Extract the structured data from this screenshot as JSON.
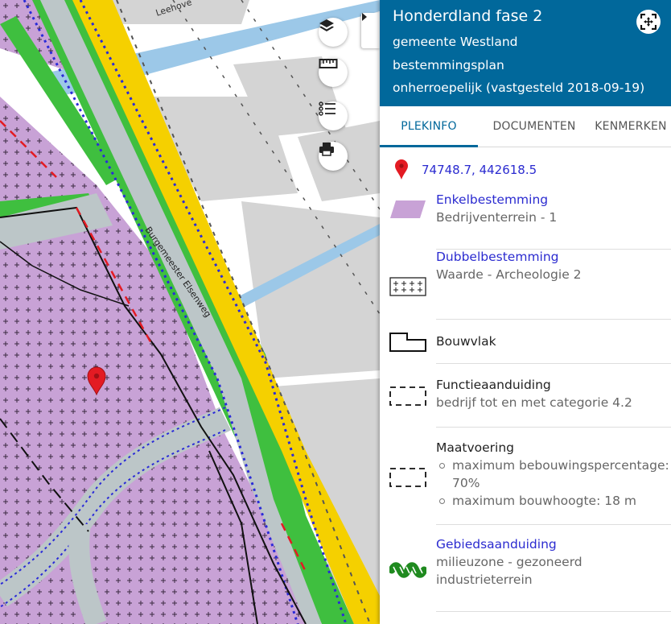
{
  "map": {
    "street_label_top": "Leehove",
    "street_label_diag": "Burgemeester Elsenweg",
    "controls": [
      {
        "name": "layers",
        "icon": "layers-icon"
      },
      {
        "name": "measure",
        "icon": "ruler-icon"
      },
      {
        "name": "legend",
        "icon": "list-icon"
      },
      {
        "name": "print",
        "icon": "printer-icon"
      }
    ],
    "marker_icon": "map-marker-icon",
    "colors": {
      "purple_zone": "#c8a2d6",
      "road_yellow": "#f5d000",
      "green_strip": "#3fbf3f",
      "water": "#9cc8e8",
      "building_gray": "#d4d4d4",
      "blue_dotted": "#2a2ad8",
      "marker_red": "#e31b23"
    }
  },
  "panel": {
    "title": "Honderdland fase 2",
    "municipality": "gemeente Westland",
    "type": "bestemmingsplan",
    "status": "onherroepelijk (vastgesteld 2018-09-19)",
    "header_color": "#01689b",
    "tabs": [
      {
        "label": "PLEKINFO",
        "active": true
      },
      {
        "label": "DOCUMENTEN",
        "active": false
      },
      {
        "label": "KENMERKEN",
        "active": false
      }
    ],
    "coordinates": "74748.7, 442618.5",
    "entries": [
      {
        "label": "Enkelbestemming",
        "link": true,
        "sub": "Bedrijventerrein - 1"
      },
      {
        "label": "Dubbelbestemming",
        "link": true,
        "sub": "Waarde - Archeologie 2"
      },
      {
        "label": "Bouwvlak",
        "link": false
      },
      {
        "label": "Functieaanduiding",
        "link": false,
        "sub": "bedrijf tot en met categorie 4.2"
      },
      {
        "label": "Maatvoering",
        "link": false,
        "items": [
          "maximum bebouwingspercentage: 70%",
          "maximum bouwhoogte: 18 m"
        ]
      },
      {
        "label": "Gebiedsaanduiding",
        "link": true,
        "sub": "milieuzone - gezoneerd industrieterrein"
      }
    ]
  }
}
